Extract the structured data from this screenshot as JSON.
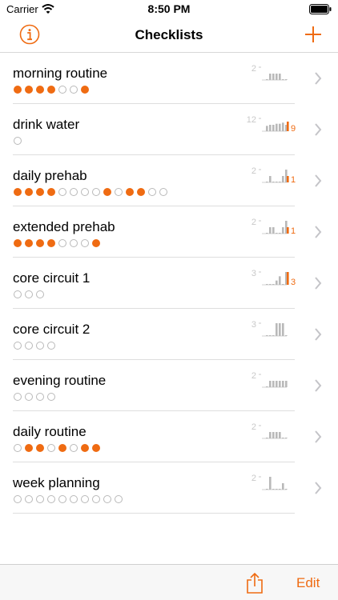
{
  "status_bar": {
    "carrier": "Carrier",
    "time": "8:50 PM"
  },
  "nav": {
    "title": "Checklists"
  },
  "colors": {
    "accent": "#ef6b12",
    "empty_dot": "#b9b9b9",
    "bar_gray": "#b9b9b9"
  },
  "icons": {
    "info": "info-circle-icon",
    "add": "plus-icon",
    "chevron": "chevron-right-icon",
    "share": "share-icon",
    "wifi": "wifi-icon",
    "battery": "battery-icon"
  },
  "checklists": [
    {
      "title": "morning routine",
      "dots": [
        1,
        1,
        1,
        1,
        0,
        0,
        1
      ],
      "max_label": "2",
      "history": [
        0,
        1,
        1,
        1,
        1,
        0,
        0
      ],
      "today": null
    },
    {
      "title": "drink water",
      "dots": [
        0
      ],
      "max_label": "12",
      "history": [
        5,
        6,
        6,
        7,
        7,
        8,
        6
      ],
      "today": 9
    },
    {
      "title": "daily prehab",
      "dots": [
        1,
        1,
        1,
        1,
        0,
        0,
        0,
        0,
        1,
        0,
        1,
        1,
        0,
        0
      ],
      "max_label": "2",
      "history": [
        0,
        1,
        0,
        0,
        0,
        1,
        2
      ],
      "today": 1
    },
    {
      "title": "extended prehab",
      "dots": [
        1,
        1,
        1,
        1,
        0,
        0,
        0,
        1
      ],
      "max_label": "2",
      "history": [
        0,
        1,
        1,
        0,
        0,
        1,
        2
      ],
      "today": 1
    },
    {
      "title": "core circuit 1",
      "dots": [
        0,
        0,
        0
      ],
      "max_label": "3",
      "history": [
        0,
        0,
        0,
        1,
        2,
        0,
        3
      ],
      "today": 3
    },
    {
      "title": "core circuit 2",
      "dots": [
        0,
        0,
        0,
        0
      ],
      "max_label": "3",
      "history": [
        0,
        0,
        0,
        3,
        3,
        3,
        0
      ],
      "today": null
    },
    {
      "title": "evening routine",
      "dots": [
        0,
        0,
        0,
        0
      ],
      "max_label": "2",
      "history": [
        0,
        1,
        1,
        1,
        1,
        1,
        1
      ],
      "today": null
    },
    {
      "title": "daily routine",
      "dots": [
        0,
        1,
        1,
        0,
        1,
        0,
        1,
        1
      ],
      "max_label": "2",
      "history": [
        0,
        1,
        1,
        1,
        1,
        0,
        0
      ],
      "today": null
    },
    {
      "title": "week planning",
      "dots": [
        0,
        0,
        0,
        0,
        0,
        0,
        0,
        0,
        0,
        0
      ],
      "max_label": "2",
      "history": [
        0,
        2,
        0,
        0,
        0,
        1,
        0
      ],
      "today": null
    }
  ],
  "toolbar": {
    "edit_label": "Edit"
  }
}
